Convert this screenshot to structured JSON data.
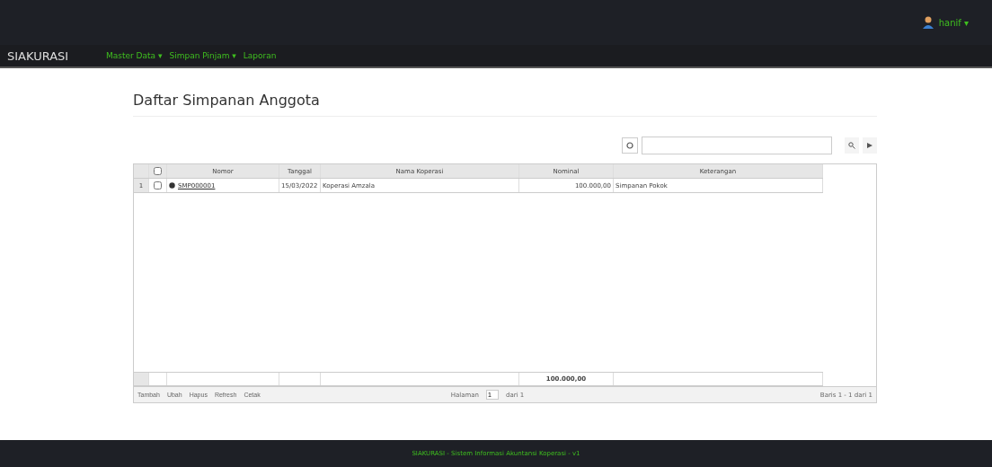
{
  "topbar": {
    "user": "hanif ▾"
  },
  "navbar": {
    "brand": "SIAKURASI",
    "menu": [
      {
        "label": "Master Data ▾"
      },
      {
        "label": "Simpan Pinjam ▾"
      },
      {
        "label": "Laporan"
      }
    ]
  },
  "page": {
    "title": "Daftar Simpanan Anggota"
  },
  "table": {
    "select_all": false,
    "columns": [
      "Nomor",
      "Tanggal",
      "Nama Koperasi",
      "Nominal",
      "Keterangan"
    ],
    "rows": [
      {
        "index": "1",
        "checked": false,
        "nomor": "SMP000001",
        "tanggal": "15/03/2022",
        "koperasi": "Koperasi Amzala",
        "nominal": "100.000,00",
        "keterangan": "Simpanan Pokok"
      }
    ],
    "total": "100.000,00"
  },
  "pager": {
    "actions": [
      "Tambah",
      "Ubah",
      "Hapus",
      "Refresh",
      "Cetak"
    ],
    "page_label": "Halaman",
    "page": "1",
    "of": "dari 1",
    "rows_info": "Baris 1 - 1 dari 1"
  },
  "footer": {
    "text": "SIAKURASI - Sistem Informasi Akuntansi Koperasi - v1"
  }
}
